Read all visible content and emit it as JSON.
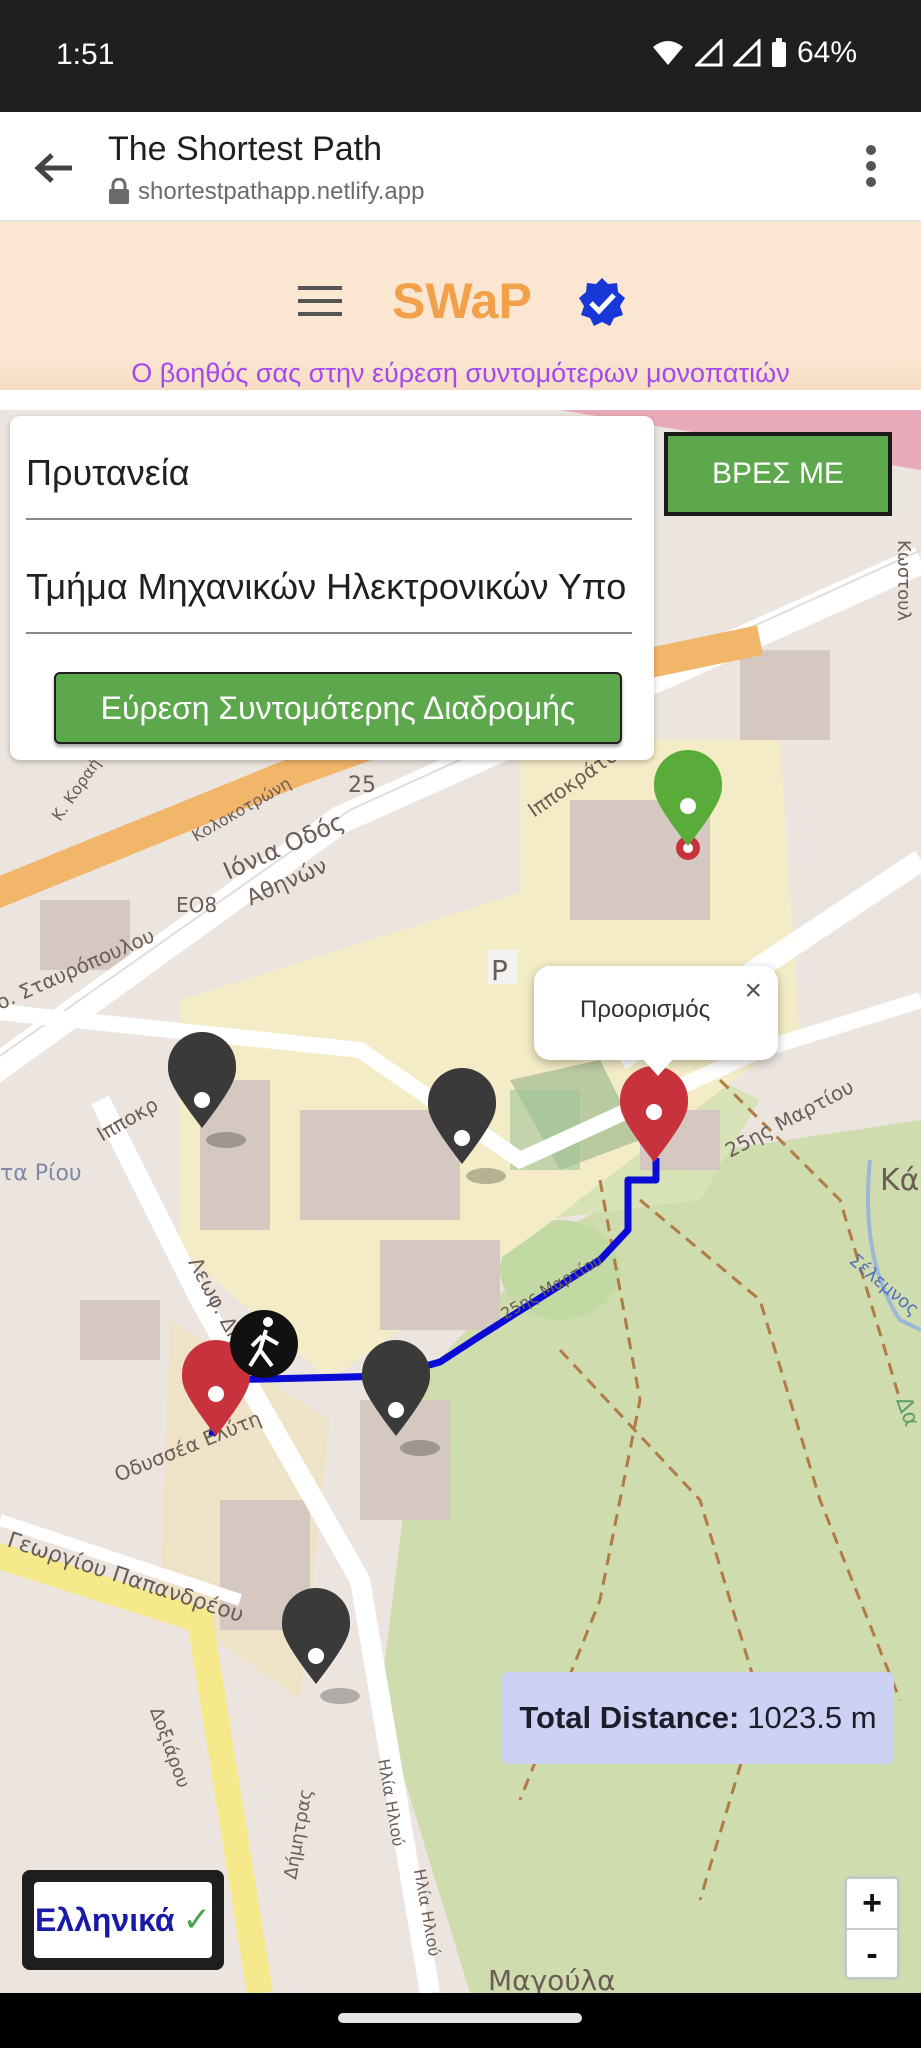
{
  "status_bar": {
    "time": "1:51",
    "battery": "64%"
  },
  "browser": {
    "title": "The Shortest Path",
    "url": "shortestpathapp.netlify.app"
  },
  "app": {
    "brand": "SWaP",
    "tagline": "Ο βοηθός σας στην εύρεση συντομότερων μονοπατιών"
  },
  "form": {
    "origin": "Πρυτανεία",
    "destination": "Τμήμα Μηχανικών Ηλεκτρονικών Υπο",
    "route_button": "Εύρεση Συντομότερης Διαδρομής"
  },
  "locate_button": "ΒΡΕΣ ΜΕ",
  "popup": {
    "text": "Προορισμός",
    "close": "×"
  },
  "distance": {
    "label": "Total Distance:",
    "value": "1023.5 m"
  },
  "language": {
    "label": "Ελληνικά",
    "check": "✓"
  },
  "zoom": {
    "in": "+",
    "out": "-"
  },
  "map_labels": {
    "ionia": "Ιόνια Οδός",
    "athinon": "Αθηνών",
    "eo8": "ΕΟ8",
    "road25": "25",
    "hippokratous": "Ιπποκράτους",
    "hippokr2": "Ιπποκρ",
    "martiou": "25ης Μαρτίου",
    "martiou2": "25ης Μαρτίου",
    "stavropoulou": "ο. Σταυρόπουλου",
    "kolokotroni": "Κολοκοτρώνη",
    "korai": "Κ. Κοραή",
    "riou": "τα Ρίου",
    "odyssea": "Οδυσσέα Ελύτη",
    "leoforos": "Λεωφ. Δημ.",
    "papandreou": "Γεωργίου Παπανδρέου",
    "doxiou": "Δοξιάρου",
    "ilia": "Ηλία Ηλιού",
    "ilia2": "Ηλία Ηλιού",
    "dimitras": "Δήμητρας",
    "magoula": "Μαγούλα",
    "selemnos": "Σέλεμνος",
    "ka": "Κά",
    "da": "Δα",
    "xostou": "Κωστουλ",
    "parking": "P"
  },
  "colors": {
    "route": "#0b0bd6",
    "marker_dest": "#c8323c",
    "marker_start": "#5aac3a",
    "marker_poi": "#3a3a3a",
    "header_bg": "#fbe6d1",
    "accent": "#f2a14a"
  }
}
